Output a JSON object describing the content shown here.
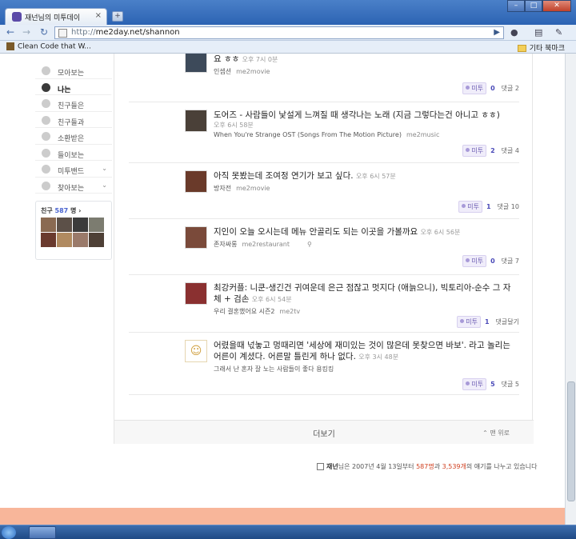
{
  "browser": {
    "tab_title": "재넌님의 미투데이",
    "tab_close": "×",
    "new_tab": "+",
    "url_scheme": "http://",
    "url_rest": "me2day.net/shannon",
    "window_buttons": [
      "–",
      "□",
      "✕"
    ]
  },
  "bookmarks": {
    "left_label": "Clean Code that W...",
    "right_label": "기타 북마크"
  },
  "sidebar": {
    "items": [
      {
        "label": "모아보는",
        "icon": "collect-icon"
      },
      {
        "label": "나는",
        "icon": "me-icon",
        "active": true
      },
      {
        "label": "친구들은",
        "icon": "friends-icon"
      },
      {
        "label": "친구들과",
        "icon": "chat-icon"
      },
      {
        "label": "소환받은",
        "icon": "summon-icon"
      },
      {
        "label": "들이보는",
        "icon": "footprint-icon"
      },
      {
        "label": "미투밴드",
        "icon": "band-icon",
        "has_chevron": true
      },
      {
        "label": "찾아보는",
        "icon": "search-star-icon",
        "has_chevron": true
      }
    ],
    "chevron": "⌄",
    "friends_label": "친구",
    "friends_count": "587",
    "friends_unit": "명 ›"
  },
  "posts": [
    {
      "title": "요 ㅎㅎ",
      "time": "오후 7시 0분",
      "tags": [
        "인셉션",
        "me2movie"
      ],
      "me2_label": "미투",
      "me2_count": "0",
      "comment": "댓글 2",
      "avatar_color": "#3d4a5a"
    },
    {
      "title": "도어즈 - 사람들이 낯설게 느껴질 때 생각나는 노래 (지금 그렇다는건 아니고 ㅎㅎ)",
      "time": "오후 6시 58분",
      "tags": [
        "When You're Strange OST (Songs From The Motion Picture)",
        "me2music"
      ],
      "me2_label": "미투",
      "me2_count": "2",
      "comment": "댓글 4",
      "avatar_color": "#4a4038"
    },
    {
      "title": "아직 못봤는데 조여정 연기가 보고 싶다.",
      "time": "오후 6시 57분",
      "tags": [
        "방자전",
        "me2movie"
      ],
      "me2_label": "미투",
      "me2_count": "1",
      "comment": "댓글 10",
      "avatar_color": "#6a3a2a"
    },
    {
      "title": "지인이 오늘 오시는데 메뉴 안골리도 되는 이곳을 가볼까요",
      "time": "오후 6시 56분",
      "tags": [
        "존자싸롱",
        "me2restaurant"
      ],
      "me2_label": "미투",
      "me2_count": "0",
      "comment": "댓글 7",
      "avatar_color": "#7a4a3a"
    },
    {
      "title": "최강커플: 니쿤-생긴건 귀여운데 은근 점잖고 멋지다 (애늙으니), 빅토리아-순수 그 자체 + 검손",
      "time": "오후 6시 54분",
      "tags": [
        "우리 결혼했어요 시즌2",
        "me2tv"
      ],
      "me2_label": "미투",
      "me2_count": "1",
      "comment": "댓글달기",
      "avatar_color": "#8a3030"
    },
    {
      "title": "어렸을때 넋놓고 멍때리면 '세상에 재미있는 것이 많은데 못찾으면 바보'. 라고 놀리는 어른이 계셨다. 어른말 틀린게 하나 없다.",
      "time": "오후 3시 48분",
      "tags": [
        "그래서 난 혼자 잘 노는 사람들이 좋다 용킹킹"
      ],
      "me2_label": "미투",
      "me2_count": "5",
      "comment": "댓글 5",
      "avatar_color": "#ffffff"
    }
  ],
  "more": {
    "label": "더보기",
    "top_label": "맨 위로"
  },
  "footer": {
    "name": "재넌",
    "p1": "님은 2007년 4월 13일부터 ",
    "friends": "587명",
    "p2": "과 ",
    "count": "3,539개",
    "p3": "의 얘기를 나누고 있습니다"
  }
}
